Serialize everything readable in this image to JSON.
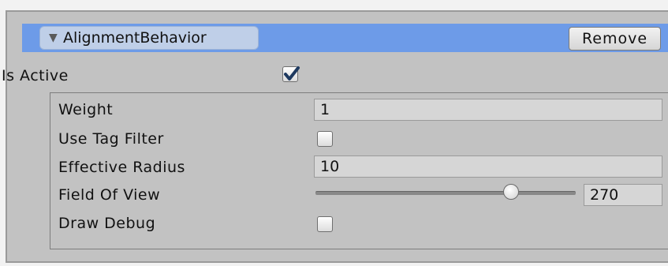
{
  "component": {
    "name": "AlignmentBehavior",
    "remove_label": "Remove",
    "foldout_icon": "triangle-down-icon"
  },
  "is_active": {
    "label": "Is Active",
    "checked": true
  },
  "properties": {
    "weight": {
      "label": "Weight",
      "value": "1"
    },
    "use_tag_filter": {
      "label": "Use Tag Filter",
      "checked": false
    },
    "effective_radius": {
      "label": "Effective Radius",
      "value": "10"
    },
    "field_of_view": {
      "label": "Field Of View",
      "value": "270",
      "slider_fraction": 0.75
    },
    "draw_debug": {
      "label": "Draw Debug",
      "checked": false
    }
  },
  "colors": {
    "header": "#6d9be8",
    "panel": "#c2c2c2",
    "field": "#d6d6d6",
    "checkmark": "#1f3a60"
  }
}
